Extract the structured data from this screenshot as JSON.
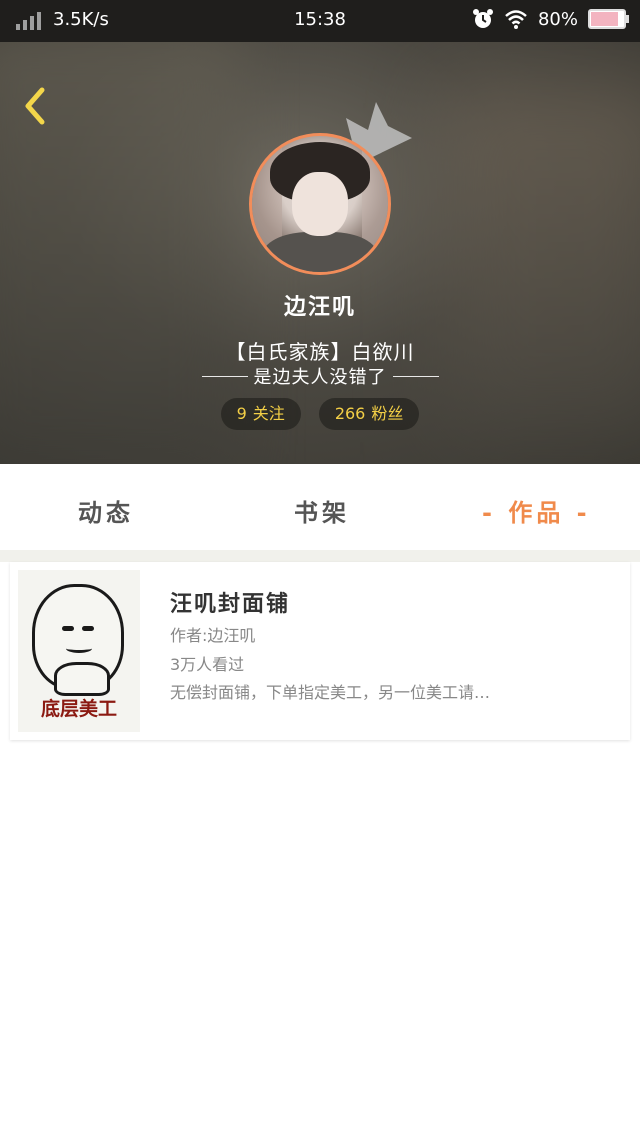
{
  "status_bar": {
    "network_speed": "3.5K/s",
    "time": "15:38",
    "battery": "80%",
    "battery_level": 0.8,
    "icons": [
      "signal-icon",
      "alarm-icon",
      "wifi-icon",
      "battery-icon"
    ]
  },
  "profile": {
    "username": "边汪叽",
    "bio_line1": "【白氏家族】白欲川",
    "bio_line2": "是边夫人没错了",
    "following": {
      "count": "9",
      "label": "关注"
    },
    "followers": {
      "count": "266",
      "label": "粉丝"
    }
  },
  "tabs": [
    {
      "label": "动态",
      "active": false
    },
    {
      "label": "书架",
      "active": false
    },
    {
      "label": "- 作品 -",
      "active": true
    }
  ],
  "works": [
    {
      "cover_text": "底层美工",
      "title": "汪叽封面铺",
      "author": "作者:边汪叽",
      "views": "3万人看过",
      "description": "无偿封面铺，下单指定美工，另一位美工请…"
    }
  ],
  "colors": {
    "accent": "#f08a4b",
    "stat_text": "#f3cf46",
    "avatar_border": "#f28d5a"
  }
}
